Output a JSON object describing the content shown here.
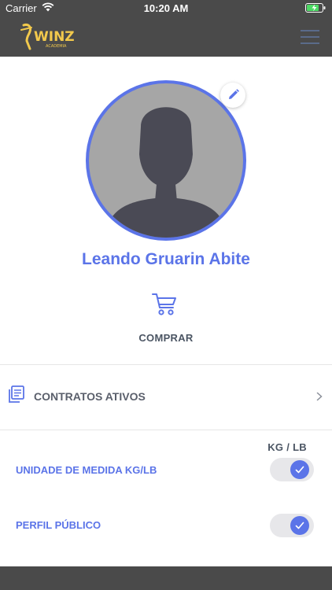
{
  "status_bar": {
    "carrier": "Carrier",
    "time": "10:20 AM"
  },
  "header": {
    "logo_text": "WINZ",
    "logo_subtext": "ACADEMIA",
    "menu_icon": "hamburger-menu-icon"
  },
  "profile": {
    "name": "Leando Gruarin Abite",
    "edit_icon": "pencil-icon"
  },
  "buy": {
    "label": "COMPRAR",
    "icon": "shopping-cart-icon"
  },
  "contracts": {
    "label": "CONTRATOS ATIVOS",
    "icon": "documents-icon"
  },
  "settings": {
    "unit_header": "KG / LB",
    "items": [
      {
        "label": "UNIDADE DE MEDIDA KG/LB",
        "enabled": true
      },
      {
        "label": "PERFIL PÚBLICO",
        "enabled": true
      }
    ]
  },
  "colors": {
    "accent": "#5b74e8",
    "header_bg": "#4a4a4a",
    "logo": "#f2c94c",
    "toggle_track": "#e7e7ea"
  }
}
